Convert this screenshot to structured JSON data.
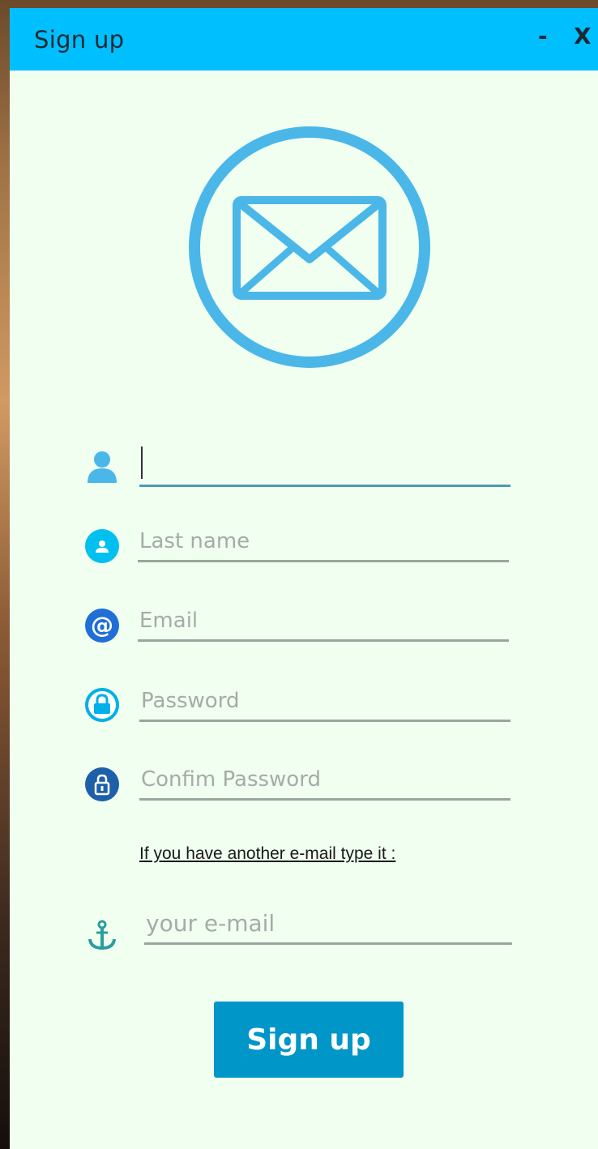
{
  "window": {
    "title": "Sign up",
    "minimize_label": "-",
    "close_label": "X"
  },
  "logo": {
    "icon": "envelope-icon",
    "color": "#4ab7e8"
  },
  "form": {
    "first_name": {
      "value": "",
      "placeholder": "",
      "icon": "user-icon"
    },
    "last_name": {
      "value": "",
      "placeholder": "Last name",
      "icon": "user-badge-icon"
    },
    "email": {
      "value": "",
      "placeholder": "Email",
      "icon": "at-sign-icon"
    },
    "password": {
      "value": "",
      "placeholder": "Password",
      "icon": "lock-icon"
    },
    "confirm_password": {
      "value": "",
      "placeholder": "Confim Password",
      "icon": "lock-dark-icon"
    },
    "hint": "If you have another e-mail type it :",
    "alt_email": {
      "value": "",
      "placeholder": "your e-mail",
      "icon": "anchor-icon"
    },
    "submit_label": "Sign up"
  },
  "colors": {
    "titlebar": "#00bfff",
    "background": "#f0fff0",
    "button": "#0096c8",
    "underline": "#9aa59c",
    "focus_underline": "#4c9bb3"
  }
}
